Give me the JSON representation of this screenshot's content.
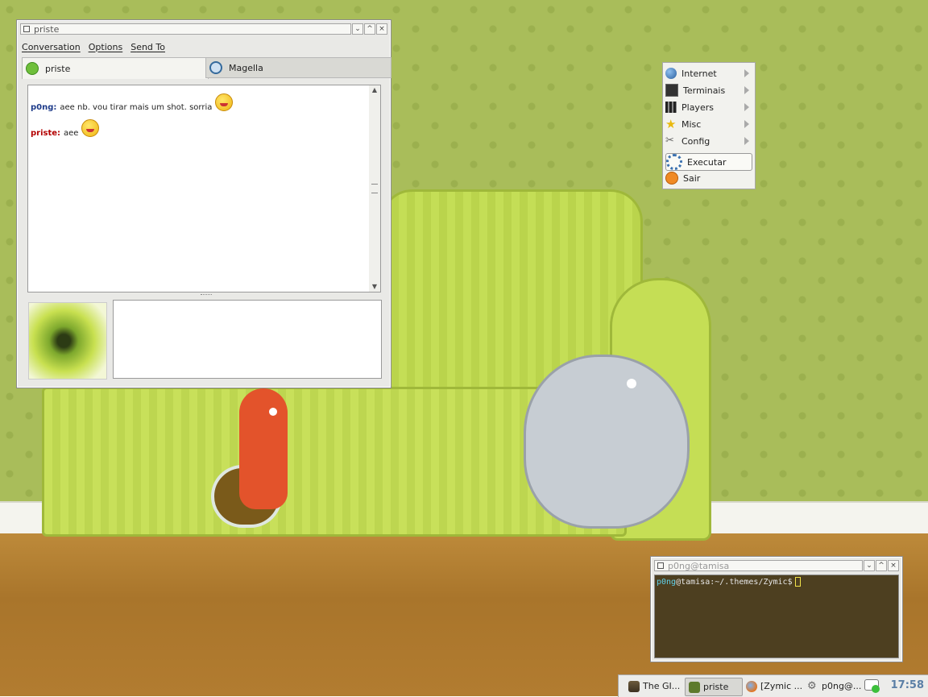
{
  "chat_window": {
    "title": "priste",
    "menu": [
      "Conversation",
      "Options",
      "Send To"
    ],
    "tabs": [
      {
        "label": "priste",
        "icon": "available-status-icon"
      },
      {
        "label": "Magella",
        "icon": "away-status-icon"
      }
    ],
    "messages": [
      {
        "nick": "p0ng:",
        "text": "aee nb. vou tirar mais um shot. sorria",
        "emoticon": "smiley-icon"
      },
      {
        "nick": "priste:",
        "text": "aee",
        "emoticon": "smiley-icon"
      }
    ],
    "input_value": ""
  },
  "app_menu": {
    "items": [
      {
        "label": "Internet",
        "icon": "globe-icon",
        "submenu": true
      },
      {
        "label": "Terminais",
        "icon": "terminal-icon",
        "submenu": true
      },
      {
        "label": "Players",
        "icon": "film-icon",
        "submenu": true
      },
      {
        "label": "Misc",
        "icon": "star-icon",
        "submenu": true
      },
      {
        "label": "Config",
        "icon": "tools-icon",
        "submenu": true
      },
      {
        "label": "Executar",
        "icon": "gear-icon",
        "submenu": false,
        "selected": true
      },
      {
        "label": "Sair",
        "icon": "power-icon",
        "submenu": false
      }
    ]
  },
  "terminal": {
    "title": "p0ng@tamisa",
    "prompt_user": "p0ng",
    "prompt_rest": "@tamisa:~/.themes/Zymic$"
  },
  "taskbar": {
    "tasks": [
      {
        "label": "The GI...",
        "icon": "gimp-icon"
      },
      {
        "label": "priste",
        "icon": "pidgin-icon",
        "active": true
      },
      {
        "label": "[Zymic ...",
        "icon": "firefox-icon"
      },
      {
        "label": "p0ng@...",
        "icon": "terminal-gear-icon"
      }
    ],
    "clock": "17:58"
  },
  "colors": {
    "nick_self": "#1e3b8a",
    "nick_buddy": "#b30000",
    "terminal_bg": "#4d3f20",
    "wallpaper": "#a9bd5a"
  }
}
